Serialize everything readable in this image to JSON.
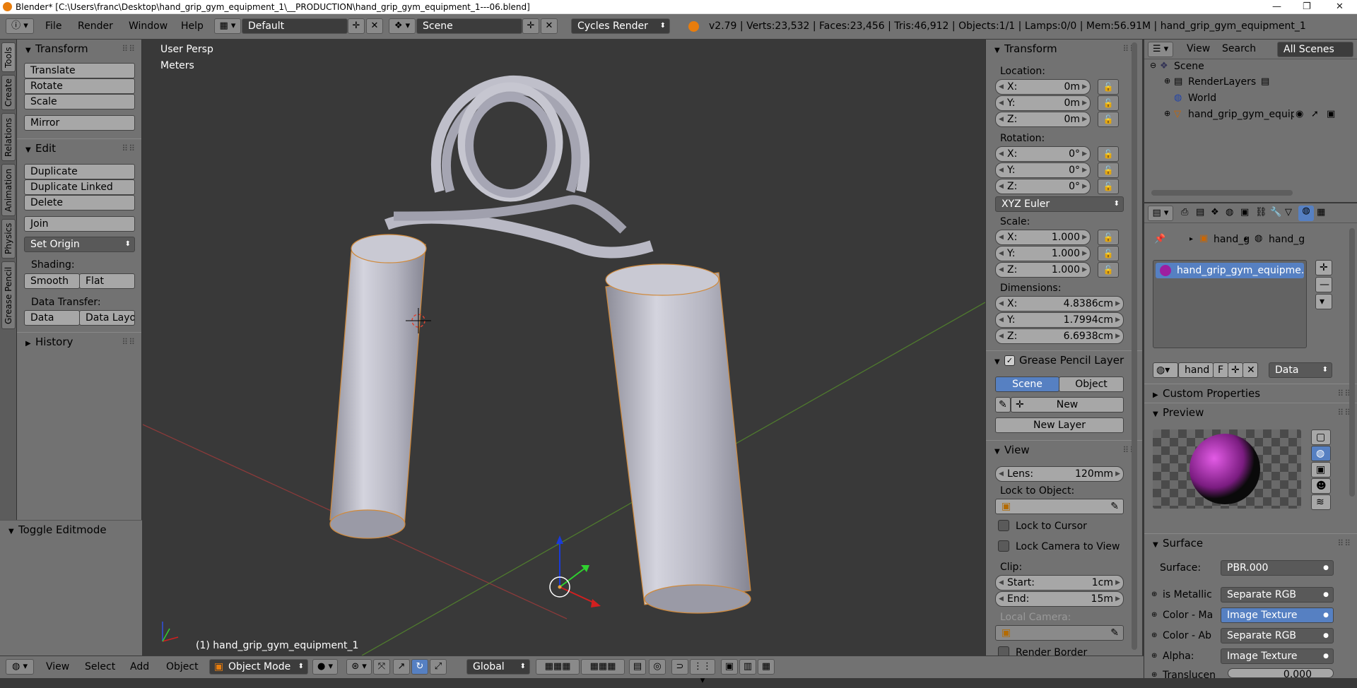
{
  "window": {
    "title": "Blender* [C:\\Users\\franc\\Desktop\\hand_grip_gym_equipment_1\\__PRODUCTION\\hand_grip_gym_equipment_1---06.blend]",
    "minimize": "—",
    "maximize": "❐",
    "close": "✕"
  },
  "info_header": {
    "menus": [
      "File",
      "Render",
      "Window",
      "Help"
    ],
    "layout": "Default",
    "scene": "Scene",
    "engine": "Cycles Render",
    "stats": "v2.79 | Verts:23,532 | Faces:23,456 | Tris:46,912 | Objects:1/1 | Lamps:0/0 | Mem:56.91M | hand_grip_gym_equipment_1"
  },
  "vertical_tabs": [
    "Tools",
    "Create",
    "Relations",
    "Animation",
    "Physics",
    "Grease Pencil"
  ],
  "tool_shelf": {
    "transform_title": "Transform",
    "transform_buttons": [
      "Translate",
      "Rotate",
      "Scale"
    ],
    "mirror": "Mirror",
    "edit_title": "Edit",
    "edit_buttons": [
      "Duplicate",
      "Duplicate Linked",
      "Delete"
    ],
    "join": "Join",
    "set_origin": "Set Origin",
    "shading_label": "Shading:",
    "smooth": "Smooth",
    "flat": "Flat",
    "data_transfer_label": "Data Transfer:",
    "data": "Data",
    "data_layout": "Data Layo",
    "history_title": "History",
    "toggle_editmode": "Toggle Editmode"
  },
  "viewport": {
    "view_name": "User Persp",
    "units": "Meters",
    "object_label": "(1) hand_grip_gym_equipment_1"
  },
  "n_panel": {
    "transform_title": "Transform",
    "location_label": "Location:",
    "location": [
      {
        "k": "X:",
        "v": "0m"
      },
      {
        "k": "Y:",
        "v": "0m"
      },
      {
        "k": "Z:",
        "v": "0m"
      }
    ],
    "rotation_label": "Rotation:",
    "rotation": [
      {
        "k": "X:",
        "v": "0°"
      },
      {
        "k": "Y:",
        "v": "0°"
      },
      {
        "k": "Z:",
        "v": "0°"
      }
    ],
    "rotation_mode": "XYZ Euler",
    "scale_label": "Scale:",
    "scale": [
      {
        "k": "X:",
        "v": "1.000"
      },
      {
        "k": "Y:",
        "v": "1.000"
      },
      {
        "k": "Z:",
        "v": "1.000"
      }
    ],
    "dimensions_label": "Dimensions:",
    "dimensions": [
      {
        "k": "X:",
        "v": "4.8386cm"
      },
      {
        "k": "Y:",
        "v": "1.7994cm"
      },
      {
        "k": "Z:",
        "v": "6.6938cm"
      }
    ],
    "grease_title": "Grease Pencil Layer",
    "scene_btn": "Scene",
    "object_btn": "Object",
    "new_btn": "New",
    "new_layer_btn": "New Layer",
    "view_title": "View",
    "lens_k": "Lens:",
    "lens_v": "120mm",
    "lock_to_object": "Lock to Object:",
    "lock_cursor": "Lock to Cursor",
    "lock_camera": "Lock Camera to View",
    "clip_label": "Clip:",
    "clip_start_k": "Start:",
    "clip_start_v": "1cm",
    "clip_end_k": "End:",
    "clip_end_v": "15m",
    "local_camera": "Local Camera:",
    "render_border": "Render Border"
  },
  "outliner": {
    "view": "View",
    "search": "Search",
    "all_scenes": "All Scenes",
    "items": [
      "Scene",
      "RenderLayers",
      "World",
      "hand_grip_gym_equipr"
    ]
  },
  "properties": {
    "breadcrumb": [
      "hand_g",
      "hand_g"
    ],
    "material_slot": "hand_grip_gym_equipme...",
    "material_name": "hand",
    "fake_user": "F",
    "link_type": "Data",
    "custom_props": "Custom Properties",
    "preview": "Preview",
    "surface_title": "Surface",
    "surface_label": "Surface:",
    "surface_value": "PBR.000",
    "rows": [
      {
        "k": "is Metallic",
        "v": "Separate RGB"
      },
      {
        "k": "Color - Ma",
        "v": "Image Texture"
      },
      {
        "k": "Color - Ab",
        "v": "Separate RGB"
      },
      {
        "k": "Alpha:",
        "v": "Image Texture"
      }
    ],
    "translucent_k": "Translucen",
    "translucent_v": "0.000"
  },
  "bottom_bar": {
    "view": "View",
    "select": "Select",
    "add": "Add",
    "object": "Object",
    "mode": "Object Mode",
    "orientation": "Global"
  }
}
